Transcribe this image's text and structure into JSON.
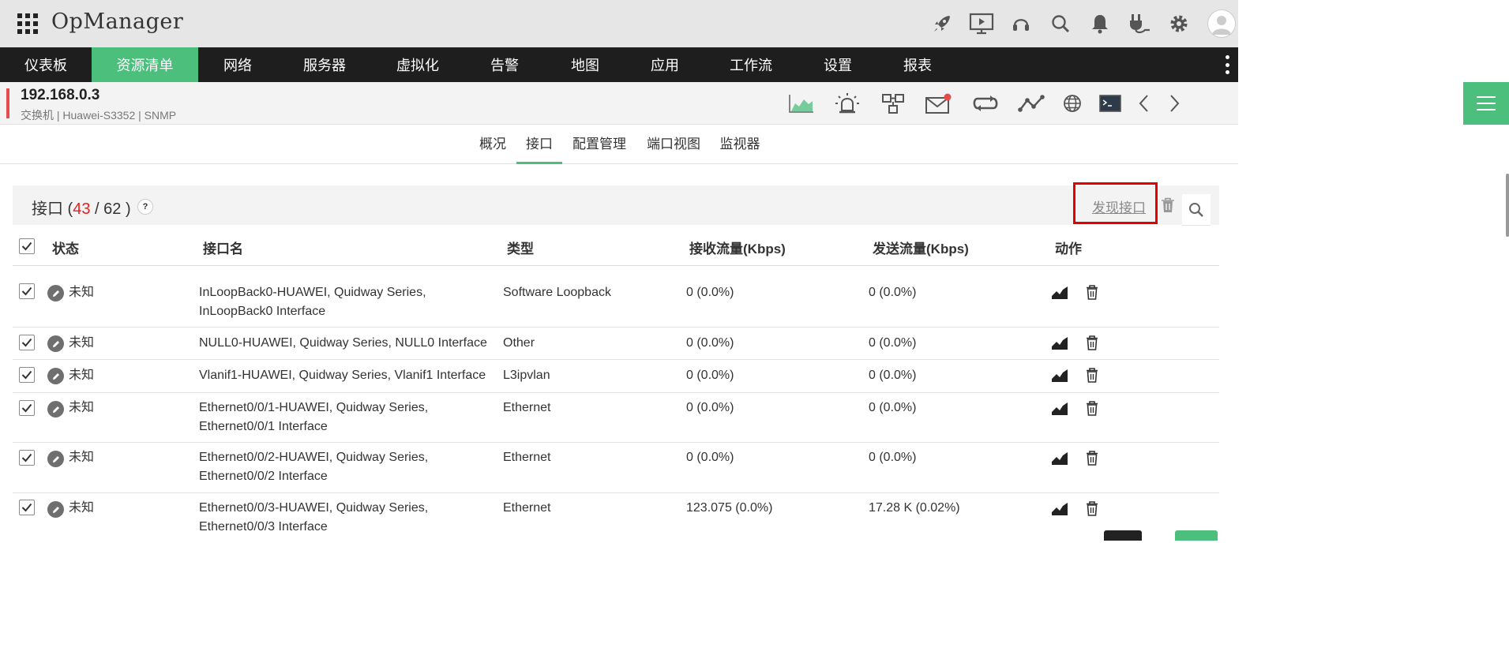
{
  "app": {
    "title": "OpManager"
  },
  "topbar_icons": [
    "rocket-icon",
    "presentation-icon",
    "headset-icon",
    "search-icon",
    "bell-icon",
    "plug-icon",
    "gear-icon",
    "user-avatar-icon"
  ],
  "nav": {
    "items": [
      "仪表板",
      "资源清单",
      "网络",
      "服务器",
      "虚拟化",
      "告警",
      "地图",
      "应用",
      "工作流",
      "设置",
      "报表"
    ],
    "active_index": 1
  },
  "device": {
    "ip": "192.168.0.3",
    "subtitle": "交换机 | Huawei-S3352  | SNMP"
  },
  "device_icons": [
    "area-chart-icon",
    "alarm-icon",
    "config-icon",
    "mail-icon",
    "sync-icon",
    "topology-icon",
    "globe-icon",
    "terminal-icon",
    "prev-arrow-icon",
    "next-arrow-icon"
  ],
  "subtabs": {
    "items": [
      "概况",
      "接口",
      "配置管理",
      "端口视图",
      "监视器"
    ],
    "active_index": 1
  },
  "panel": {
    "title_prefix": "接口 (",
    "count_shown": "43",
    "separator": "/",
    "count_total": "62",
    "title_suffix": ")",
    "help": "?",
    "discover_label": "发现接口"
  },
  "table": {
    "columns": [
      "状态",
      "接口名",
      "类型",
      "接收流量(Kbps)",
      "发送流量(Kbps)",
      "动作"
    ],
    "rows": [
      {
        "status": "未知",
        "name1": "InLoopBack0-HUAWEI, Quidway Series,",
        "name2": "InLoopBack0 Interface",
        "type": "Software Loopback",
        "rx": "0 (0.0%)",
        "tx": "0 (0.0%)"
      },
      {
        "status": "未知",
        "name1": "NULL0-HUAWEI, Quidway Series, NULL0 Interface",
        "name2": "",
        "type": "Other",
        "rx": "0 (0.0%)",
        "tx": "0 (0.0%)"
      },
      {
        "status": "未知",
        "name1": "Vlanif1-HUAWEI, Quidway Series, Vlanif1 Interface",
        "name2": "",
        "type": "L3ipvlan",
        "rx": "0 (0.0%)",
        "tx": "0 (0.0%)"
      },
      {
        "status": "未知",
        "name1": "Ethernet0/0/1-HUAWEI, Quidway Series,",
        "name2": "Ethernet0/0/1 Interface",
        "type": "Ethernet",
        "rx": "0 (0.0%)",
        "tx": "0 (0.0%)"
      },
      {
        "status": "未知",
        "name1": "Ethernet0/0/2-HUAWEI, Quidway Series,",
        "name2": "Ethernet0/0/2 Interface",
        "type": "Ethernet",
        "rx": "0 (0.0%)",
        "tx": "0 (0.0%)"
      },
      {
        "status": "未知",
        "name1": "Ethernet0/0/3-HUAWEI, Quidway Series,",
        "name2": "Ethernet0/0/3 Interface",
        "type": "Ethernet",
        "rx": "123.075 (0.0%)",
        "tx": "17.28 K (0.02%)"
      }
    ]
  },
  "colors": {
    "accent_green": "#4cbf7d",
    "nav_bg": "#1e1e1e",
    "count_red": "#e52222",
    "highlight_red": "#e80000"
  }
}
